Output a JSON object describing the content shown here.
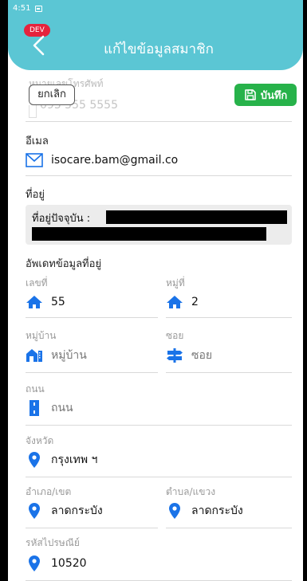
{
  "status_bar": {
    "time": "4:51"
  },
  "header": {
    "dev_badge": "DEV",
    "title": "แก้ไขข้อมูลสมาชิก"
  },
  "actions": {
    "cancel": "ยกเลิก",
    "save": "บันทึก"
  },
  "phone": {
    "label": "หมายเลขโทรศัพท์",
    "value": "095 555 5555"
  },
  "email": {
    "label": "อีเมล",
    "value": "isocare.bam@gmail.co"
  },
  "address": {
    "label": "ที่อยู่",
    "current_prefix": "ที่อยู่ปัจจุบัน :"
  },
  "update_section": {
    "label": "อัพเดทข้อมูลที่อยู่"
  },
  "fields": {
    "house_no": {
      "label": "เลขที่",
      "value": "55"
    },
    "moo": {
      "label": "หมู่ที่",
      "value": "2"
    },
    "village": {
      "label": "หมู่บ้าน",
      "placeholder": "หมู่บ้าน"
    },
    "soi": {
      "label": "ซอย",
      "placeholder": "ซอย"
    },
    "road": {
      "label": "ถนน",
      "placeholder": "ถนน"
    },
    "province": {
      "label": "จังหวัด",
      "value": "กรุงเทพ ฯ"
    },
    "district": {
      "label": "อำเภอ/เขต",
      "value": "ลาดกระบัง"
    },
    "subdistrict": {
      "label": "ตำบล/แขวง",
      "value": "ลาดกระบัง"
    },
    "postcode": {
      "label": "รหัสไปรษณีย์",
      "value": "10520"
    }
  },
  "colors": {
    "header": "#5bc6d4",
    "icon_blue": "#1a73e8",
    "save_green": "#27b24a",
    "dev_red": "#e5233d"
  }
}
